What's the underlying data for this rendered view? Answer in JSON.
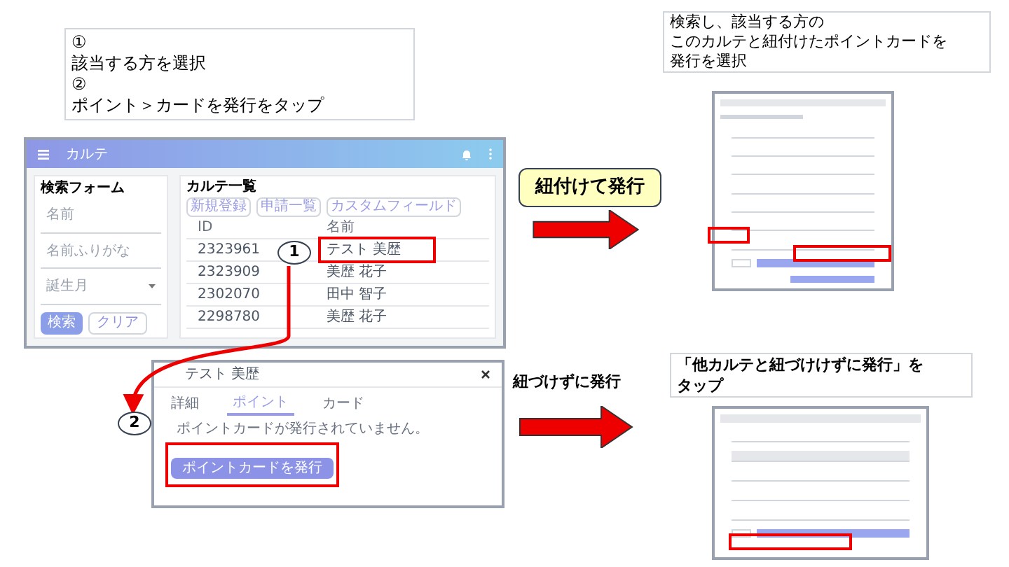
{
  "instruction_note": {
    "lines": [
      "①",
      "該当する方を選択",
      "②",
      "ポイント＞カードを発行をタップ"
    ]
  },
  "app": {
    "title": "カルテ",
    "search_form": {
      "title": "検索フォーム",
      "fields": [
        {
          "placeholder": "名前",
          "kind": "text"
        },
        {
          "placeholder": "名前ふりがな",
          "kind": "text"
        },
        {
          "placeholder": "誕生月",
          "kind": "select"
        }
      ],
      "buttons": [
        {
          "label": "検索",
          "kind": "primary"
        },
        {
          "label": "クリア",
          "kind": "outline"
        }
      ]
    },
    "chart_list": {
      "title": "カルテ一覧",
      "buttons": [
        "新規登録",
        "申請一覧",
        "カスタムフィールド"
      ],
      "columns": [
        "ID",
        "名前"
      ],
      "rows": [
        {
          "id": "2323961",
          "name": "テスト 美歴",
          "highlighted": true
        },
        {
          "id": "2323909",
          "name": "美歴 花子",
          "highlighted": false
        },
        {
          "id": "2302070",
          "name": "田中 智子",
          "highlighted": false
        },
        {
          "id": "2298780",
          "name": "美歴 花子",
          "highlighted": false
        }
      ]
    }
  },
  "dialog": {
    "title": "テスト 美歴",
    "tabs": [
      {
        "label": "詳細",
        "selected": false
      },
      {
        "label": "ポイント",
        "selected": true
      },
      {
        "label": "カード",
        "selected": false
      }
    ],
    "message": "ポイントカードが発行されていません。",
    "button": "ポイントカードを発行"
  },
  "steps": [
    "1",
    "2"
  ],
  "linked": {
    "label": "紐付けて発行",
    "note": [
      "検索し、該当する方の",
      "このカルテと紐付けたポイントカードを",
      "発行を選択"
    ]
  },
  "unlinked": {
    "label": "紐づけずに発行",
    "note": [
      "「他カルテと紐づけけずに発行」を",
      "タップ"
    ]
  }
}
